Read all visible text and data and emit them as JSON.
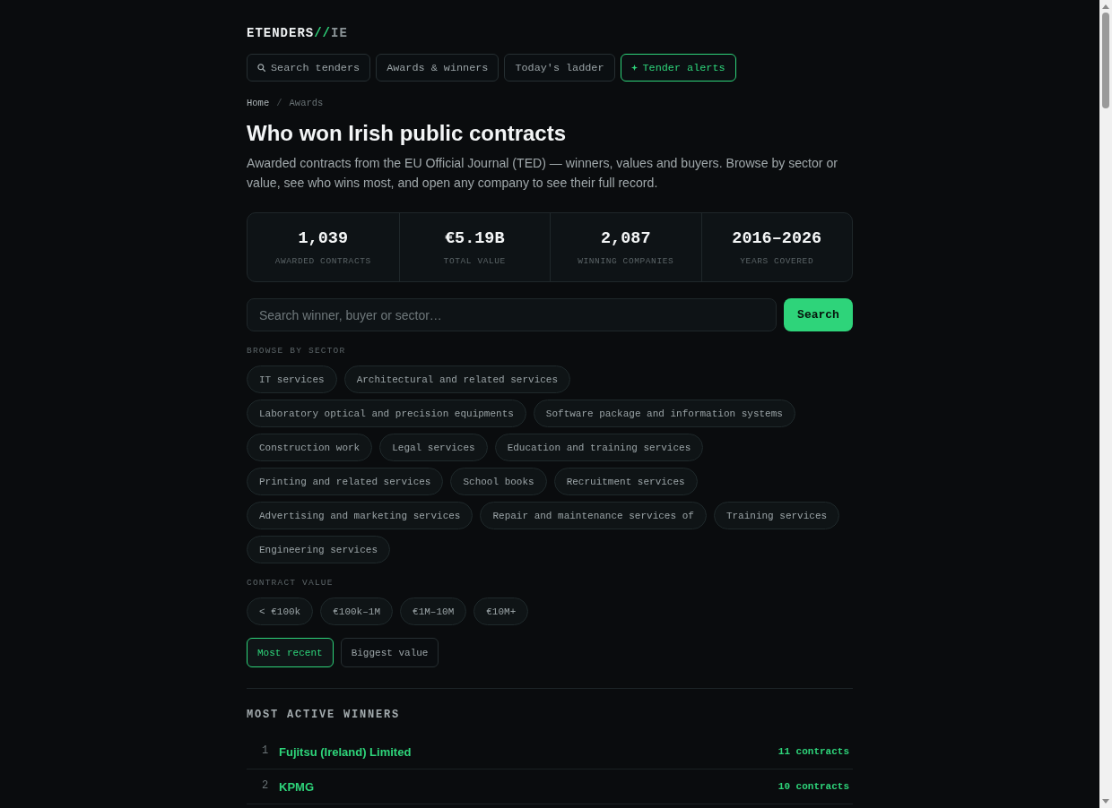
{
  "logo": {
    "name": "ETENDERS",
    "separator": "//",
    "suffix": "IE"
  },
  "nav": [
    {
      "label": "Search tenders",
      "kind": "search"
    },
    {
      "label": "Awards & winners",
      "kind": "plain"
    },
    {
      "label": "Today's ladder",
      "kind": "plain"
    },
    {
      "label": "Tender alerts",
      "kind": "alert"
    }
  ],
  "breadcrumb": {
    "separator": "/",
    "items": [
      {
        "label": "Home",
        "current": false
      },
      {
        "label": "Awards",
        "current": true
      }
    ]
  },
  "heading": "Who won Irish public contracts",
  "intro": "Awarded contracts from the EU Official Journal (TED) — winners, values and buyers. Browse by sector or value, see who wins most, and open any company to see their full record.",
  "stats": [
    {
      "value": "1,039",
      "label": "AWARDED CONTRACTS"
    },
    {
      "value": "€5.19B",
      "label": "TOTAL VALUE"
    },
    {
      "value": "2,087",
      "label": "WINNING COMPANIES"
    },
    {
      "value": "2016–2026",
      "label": "YEARS COVERED"
    }
  ],
  "search": {
    "placeholder": "Search winner, buyer or sector…",
    "button": "Search"
  },
  "sectors": {
    "title": "BROWSE BY SECTOR",
    "chips": [
      "IT services",
      "Architectural and related services",
      "Laboratory optical and precision equipments",
      "Software package and information systems",
      "Construction work",
      "Legal services",
      "Education and training services",
      "Printing and related services",
      "School books",
      "Recruitment services",
      "Advertising and marketing services",
      "Repair and maintenance services of",
      "Training services",
      "Engineering services"
    ]
  },
  "values": {
    "title": "CONTRACT VALUE",
    "chips": [
      "< €100k",
      "€100k–1M",
      "€1M–10M",
      "€10M+"
    ]
  },
  "sort": [
    {
      "label": "Most recent",
      "selected": true
    },
    {
      "label": "Biggest value",
      "selected": false
    }
  ],
  "winners": {
    "title": "MOST ACTIVE WINNERS",
    "rows": [
      {
        "rank": "1",
        "name": "Fujitsu (Ireland) Limited",
        "count": "11 contracts"
      },
      {
        "rank": "2",
        "name": "KPMG",
        "count": "10 contracts"
      }
    ]
  }
}
